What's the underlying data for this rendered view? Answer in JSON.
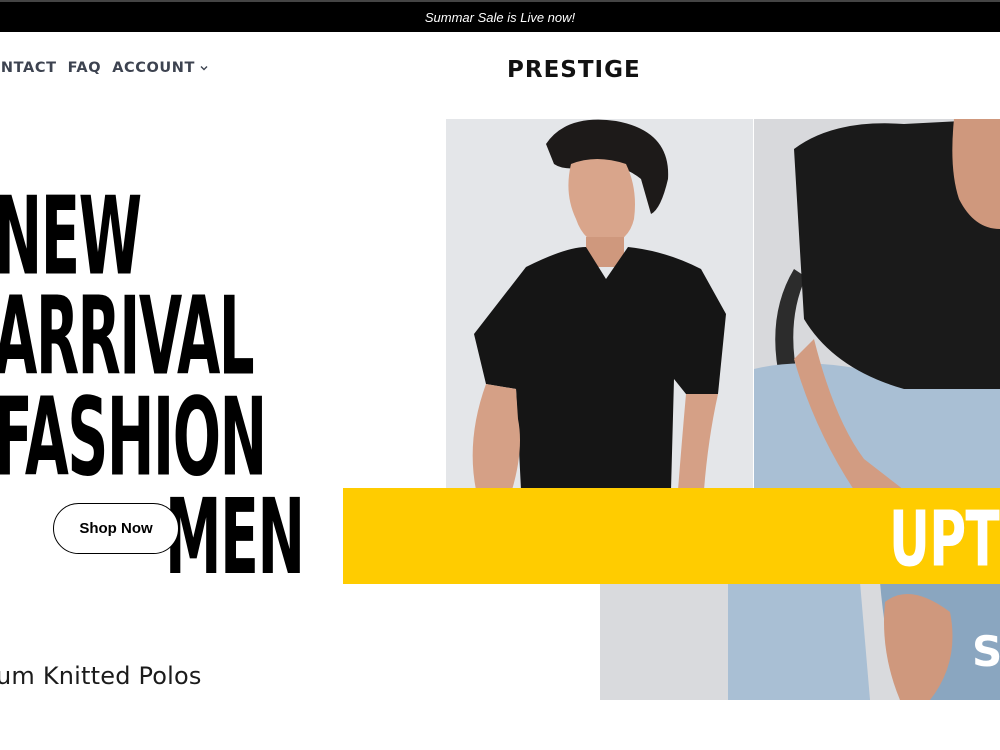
{
  "announcement": {
    "text": "Summar Sale is Live now!"
  },
  "nav": {
    "items": [
      {
        "label": "ONTACT"
      },
      {
        "label": "FAQ"
      },
      {
        "label": "ACCOUNT"
      }
    ]
  },
  "brand": {
    "logo": "PRESTIGE"
  },
  "hero": {
    "headline_lines": [
      "NEW",
      "ARRIVAL",
      "FASHION",
      "MEN"
    ],
    "cta_label": "Shop Now",
    "promo_text": "UPTO",
    "promo_sub": "S"
  },
  "product": {
    "caption": "um Knitted Polos"
  },
  "colors": {
    "accent": "#ffcc00",
    "bar": "#000000",
    "nav_text": "#3d4350"
  },
  "icons": {
    "account_caret": "chevron-down-icon"
  }
}
